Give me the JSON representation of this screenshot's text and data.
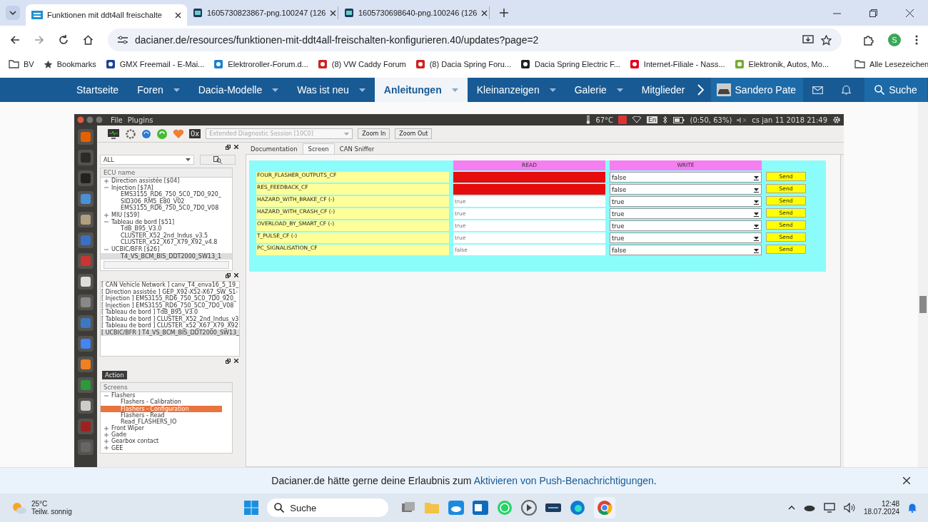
{
  "browser": {
    "tabs": [
      {
        "title": "Funktionen mit ddt4all freischalte",
        "selected": true
      },
      {
        "title": "1605730823867-png.100247 (126",
        "selected": false
      },
      {
        "title": "1605730698640-png.100246 (126",
        "selected": false
      }
    ],
    "address": "dacianer.de/resources/funktionen-mit-ddt4all-freischalten-konfigurieren.40/updates?page=2",
    "profile": "S"
  },
  "bookmarks": [
    {
      "label": "BV",
      "kind": "folder"
    },
    {
      "label": "Bookmarks",
      "kind": "star"
    },
    {
      "label": "GMX Freemail - E-Mai...",
      "kind": "gmx"
    },
    {
      "label": "Elektroroller-Forum.d...",
      "kind": "site"
    },
    {
      "label": "(8) VW Caddy Forum",
      "kind": "forum"
    },
    {
      "label": "(8) Dacia Spring Foru...",
      "kind": "forum"
    },
    {
      "label": "Dacia Spring Electric F...",
      "kind": "car"
    },
    {
      "label": "Internet-Filiale - Nass...",
      "kind": "bank"
    },
    {
      "label": "Elektronik, Autos, Mo...",
      "kind": "shop"
    }
  ],
  "bookmarks_all": "Alle Lesezeichen",
  "site_nav": {
    "items": [
      {
        "label": "Startseite",
        "selected": false,
        "dropdown": false
      },
      {
        "label": "Foren",
        "selected": false,
        "dropdown": true
      },
      {
        "label": "Dacia-Modelle",
        "selected": false,
        "dropdown": true
      },
      {
        "label": "Was ist neu",
        "selected": false,
        "dropdown": true
      },
      {
        "label": "Anleitungen",
        "selected": true,
        "dropdown": true
      },
      {
        "label": "Kleinanzeigen",
        "selected": false,
        "dropdown": true
      },
      {
        "label": "Galerie",
        "selected": false,
        "dropdown": true
      },
      {
        "label": "Mitglieder",
        "selected": false,
        "dropdown": false
      }
    ],
    "user": "Sandero Pate",
    "search": "Suche"
  },
  "app": {
    "menu": [
      "File",
      "Plugins"
    ],
    "status": {
      "temperature": "67°C",
      "keyboard": "En",
      "battery": "(0:50, 63%)",
      "clock": "cs jan 11 2018 21:49"
    },
    "hex_label": "0x",
    "session_placeholder": "Extended Diagnostic Session [10C0]",
    "toolbar_buttons": [
      "Zoom In",
      "Zoom Out"
    ],
    "tabs": [
      {
        "label": "Documentation",
        "selected": false
      },
      {
        "label": "Screen",
        "selected": true
      },
      {
        "label": "CAN Sniffer",
        "selected": false
      }
    ],
    "ecu_filter": "ALL",
    "ecu_header": "ECU name",
    "ecu_tree": [
      {
        "label": "Direction assistée [$04]",
        "expanded": false
      },
      {
        "label": "Injection [$7A]",
        "expanded": true,
        "children": [
          {
            "label": "EMS3155_RD6_750_5C0_7D0_920_",
            "selected": false
          },
          {
            "label": "SID306_RM5_E80_V02",
            "selected": false
          },
          {
            "label": "EMS3155_RD6_750_5C0_7D0_V08",
            "selected": false
          }
        ]
      },
      {
        "label": "MIU [$59]",
        "expanded": false
      },
      {
        "label": "Tableau de bord [$51]",
        "expanded": true,
        "children": [
          {
            "label": "TdB_B95_V3.0",
            "selected": false
          },
          {
            "label": "CLUSTER_X52_2nd_Indus_v3.5",
            "selected": false
          },
          {
            "label": "CLUSTER_x52_X67_X79_X92_v4.8",
            "selected": false
          }
        ]
      },
      {
        "label": "UCBIC/BFR [$26]",
        "expanded": true,
        "children": [
          {
            "label": "T4_VS_BCM_BIS_DDT2000_SW13_1",
            "selected": true
          }
        ]
      }
    ],
    "log": [
      {
        "text": "[ CAN Vehicle Network ] canv_T4_enva16_5_19_",
        "selected": false
      },
      {
        "text": "[ Direction assistée ] GEP_X92-X52-X67_SW_S1-",
        "selected": false
      },
      {
        "text": "[ Injection ] EMS3155_RD6_750_5C0_7D0_920_",
        "selected": false
      },
      {
        "text": "[ Injection ] EMS3155_RD6_750_5C0_7D0_V08",
        "selected": false
      },
      {
        "text": "[ Tableau de bord ] TdB_B95_V3.0",
        "selected": false
      },
      {
        "text": "[ Tableau de bord ] CLUSTER_X52_2nd_Indus_v3",
        "selected": false
      },
      {
        "text": "[ Tableau de bord ] CLUSTER_x52_X67_X79_X92",
        "selected": false
      },
      {
        "text": "[ UCBIC/BFR ] T4_VS_BCM_BIS_DDT2000_SW13_",
        "selected": true
      }
    ],
    "action_label": "Action",
    "screens_header": "Screens",
    "screens_tree": [
      {
        "label": "Flashers",
        "expanded": true,
        "children": [
          {
            "label": "Flashers - Calibration",
            "selected": false
          },
          {
            "label": "Flashers - Configuration",
            "selected": true
          },
          {
            "label": "Flashers - Read",
            "selected": false
          },
          {
            "label": "Read_FLASHERS_IO",
            "selected": false
          }
        ]
      },
      {
        "label": "Front Wiper",
        "expanded": false
      },
      {
        "label": "Gade",
        "expanded": false
      },
      {
        "label": "Gearbox contact",
        "expanded": false
      },
      {
        "label": "GEE",
        "expanded": false
      }
    ],
    "table": {
      "columns": [
        "READ",
        "WRITE"
      ],
      "rows": [
        {
          "name": "FOUR_FLASHER_OUTPUTS_CF",
          "error": true,
          "write": "false",
          "send": "Send"
        },
        {
          "name": "RES_FEEDBACK_CF",
          "error": true,
          "write": "false",
          "send": "Send"
        },
        {
          "name": "HAZARD_WITH_BRAKE_CF (-)",
          "error": false,
          "read": "true",
          "write": "true",
          "send": "Send"
        },
        {
          "name": "HAZARD_WITH_CRASH_CF (-)",
          "error": false,
          "read": "true",
          "write": "true",
          "send": "Send"
        },
        {
          "name": "OVERLOAD_BY_SMART_CF (-)",
          "error": false,
          "read": "true",
          "write": "true",
          "send": "Send"
        },
        {
          "name": "T_PULSE_CF (-)",
          "error": false,
          "read": "true",
          "write": "true",
          "send": "Send"
        },
        {
          "name": "PC_SIGNALISATION_CF",
          "error": false,
          "read": "false",
          "write": "false",
          "send": "Send"
        }
      ]
    }
  },
  "notification": {
    "text": "Dacianer.de hätte gerne deine Erlaubnis zum",
    "link": "Aktivieren von Push-Benachrichtigungen",
    "suffix": "."
  },
  "taskbar": {
    "temperature": "25°C",
    "weather": "Teilw. sonnig",
    "search": "Suche",
    "time": "12:48",
    "date": "18.07.2024"
  }
}
